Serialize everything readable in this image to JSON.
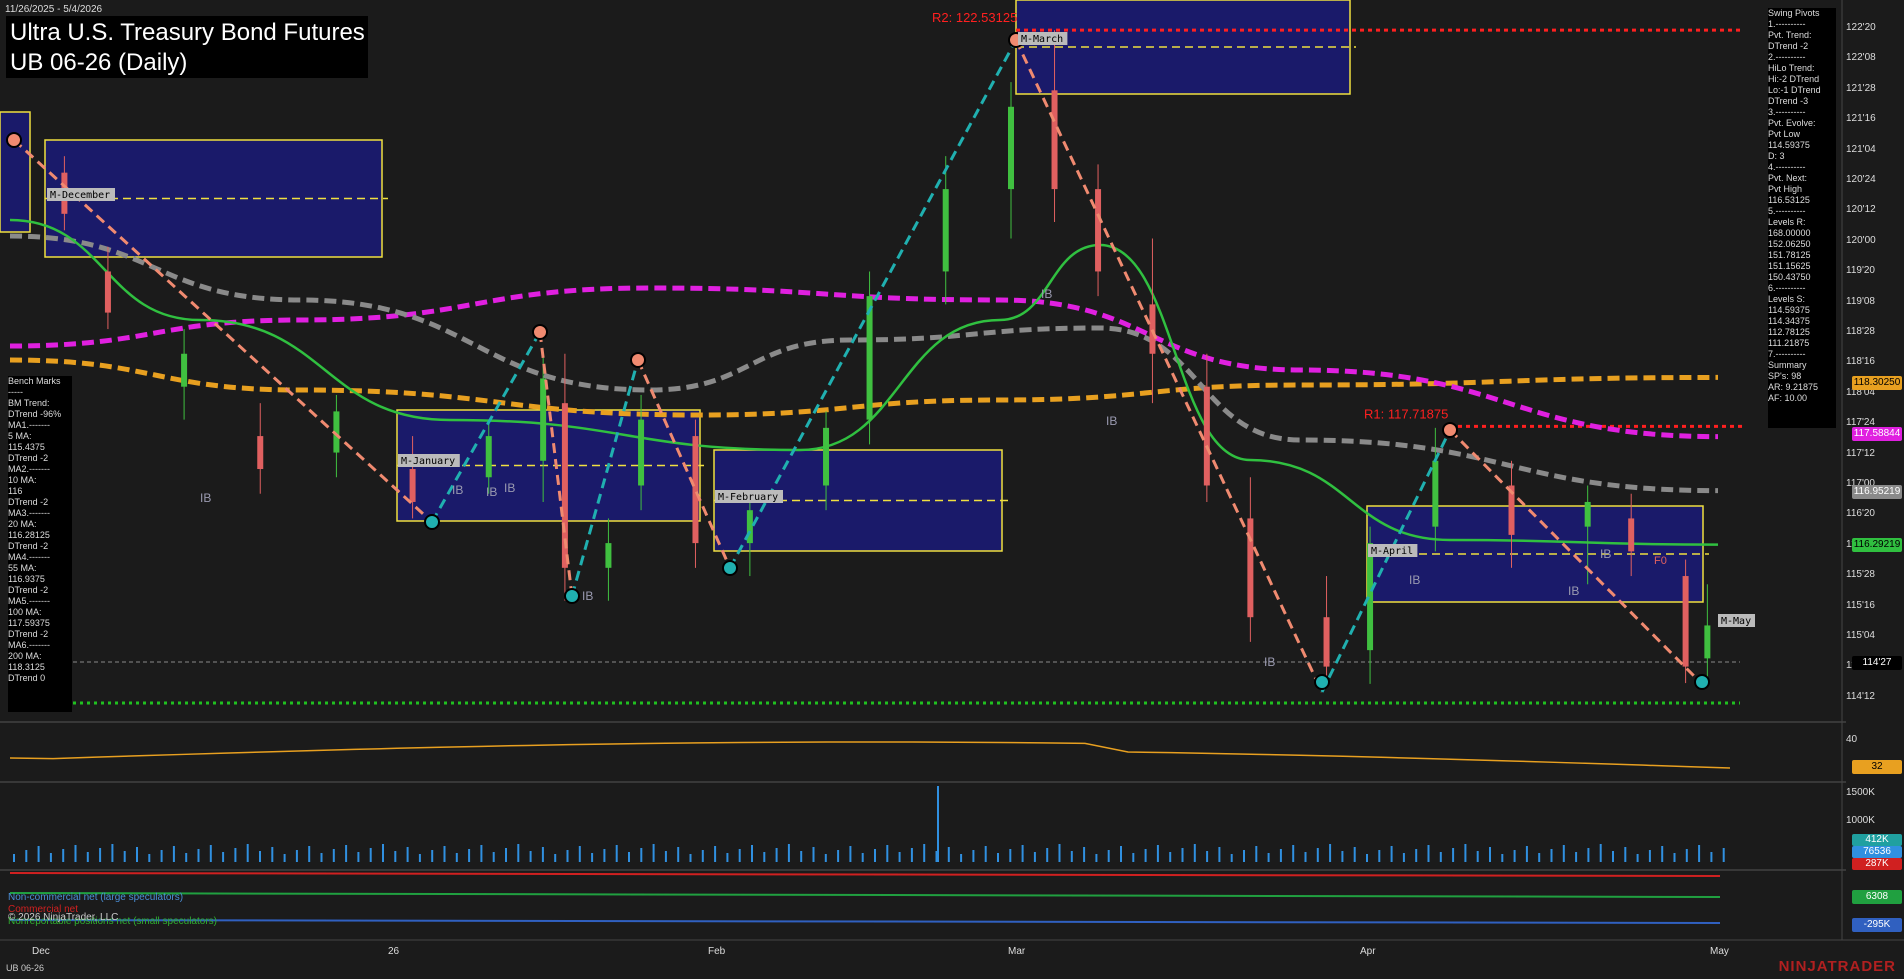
{
  "window": {
    "date_range": "11/26/2025 - 5/4/2026",
    "title_line1": "Ultra U.S. Treasury Bond Futures",
    "title_line2": "UB 06-26 (Daily)",
    "instrument_footer": "UB 06-26",
    "brand": "NINJATRADER",
    "copyright": "© 2026 NinjaTrader, LLC"
  },
  "swing_pivots": [
    "Swing Pivots",
    "1.----------",
    "Pvt. Trend:",
    "DTrend -2",
    "2.----------",
    "HiLo Trend:",
    "Hi:-2 DTrend",
    "Lo:-1 DTrend",
    "DTrend -3",
    "3.----------",
    "Pvt. Evolve:",
    "Pvt Low",
    "114.59375",
    "D: 3",
    "4.----------",
    "Pvt. Next:",
    "Pvt High",
    "116.53125",
    "5.----------",
    "Levels R:",
    "168.00000",
    "152.06250",
    "151.78125",
    "151.15625",
    "150.43750",
    "6.----------",
    "Levels S:",
    "114.59375",
    "114.34375",
    "112.78125",
    "111.21875",
    "7.----------",
    "Summary",
    "SP's: 98",
    "AR: 9.21875",
    "AF: 10.00"
  ],
  "bench_marks": [
    "Bench Marks",
    "-----",
    "BM Trend:",
    "DTrend -96%",
    "MA1.-------",
    "5 MA:",
    "115.4375",
    "DTrend -2",
    "MA2.-------",
    "10 MA:",
    "116",
    "DTrend -2",
    "MA3.-------",
    "20 MA:",
    "116.28125",
    "DTrend -2",
    "MA4.-------",
    "55 MA:",
    "116.9375",
    "DTrend -2",
    "MA5.-------",
    "100 MA:",
    "117.59375",
    "DTrend -2",
    "MA6.-------",
    "200 MA:",
    "118.3125",
    "DTrend 0"
  ],
  "price_axis": {
    "labels": [
      "122'20",
      "122'08",
      "121'28",
      "121'16",
      "121'04",
      "120'24",
      "120'12",
      "120'00",
      "119'20",
      "119'08",
      "118'28",
      "118'16",
      "118'04",
      "117'24",
      "117'12",
      "117'00",
      "116'20",
      "116'08",
      "115'28",
      "115'16",
      "115'04",
      "114'24",
      "114'12"
    ],
    "tags": [
      {
        "text": "118.30250",
        "bg": "#e8a020",
        "fg": "#000"
      },
      {
        "text": "117.58844",
        "bg": "#e020e0",
        "fg": "#fff"
      },
      {
        "text": "116.95219",
        "bg": "#8a8a8a",
        "fg": "#fff"
      },
      {
        "text": "116.29219",
        "bg": "#30c040",
        "fg": "#000"
      },
      {
        "text": "114'27",
        "bg": "#000",
        "fg": "#fff"
      }
    ]
  },
  "time_axis": [
    "Dec",
    "26",
    "Feb",
    "Mar",
    "Apr",
    "May"
  ],
  "annotations": {
    "r2": "R2: 122.53125",
    "r1": "R1: 117.71875",
    "months": [
      "M-December",
      "M-January",
      "M-February",
      "M-March",
      "M-April",
      "M-May"
    ],
    "ib": "IB",
    "f0": "F0"
  },
  "sub_panels": {
    "osc_labels": [
      "40"
    ],
    "osc_tag": {
      "text": "32",
      "bg": "#e8a020",
      "fg": "#000"
    },
    "vol_labels": [
      "1500K",
      "1000K"
    ],
    "vol_tags": [
      {
        "text": "412K",
        "bg": "#20a0a0",
        "fg": "#fff"
      },
      {
        "text": "76536",
        "bg": "#3090e0",
        "fg": "#fff"
      },
      {
        "text": "287K",
        "bg": "#d02020",
        "fg": "#fff"
      }
    ],
    "cot_tags": [
      {
        "text": "6308",
        "bg": "#20a040",
        "fg": "#fff"
      },
      {
        "text": "-295K",
        "bg": "#3060c0",
        "fg": "#fff"
      }
    ],
    "legend": [
      {
        "text": "Non-commercial net (large speculators)",
        "color": "#4a8fd8"
      },
      {
        "text": "Commercial net",
        "color": "#d02020"
      },
      {
        "text": "Nonreportable positions net (small speculators)",
        "color": "#30b030"
      }
    ]
  },
  "colors": {
    "background": "#1b1b1b",
    "up_candle": "#40c040",
    "down_candle": "#e06060",
    "ma_magenta": "#e020e0",
    "ma_orange": "#e8a020",
    "ma_gray": "#8a8a8a",
    "ma_green": "#30c040",
    "swing_teal": "#20b0b0",
    "swing_salmon": "#f08a70",
    "box_fill": "#1a1a6a",
    "box_border": "#f0e040"
  },
  "chart_data": {
    "type": "candlestick",
    "title": "UB 06-26 (Daily)",
    "y_unit": "price (points and 32nds)",
    "ylim": [
      114.2,
      122.8
    ],
    "x_range": [
      "2025-11-26",
      "2026-05-04"
    ],
    "ohlc": [
      {
        "date": "2025-12-01",
        "o": 120.8,
        "h": 121.0,
        "l": 120.1,
        "c": 120.3
      },
      {
        "date": "2025-12-05",
        "o": 119.6,
        "h": 119.9,
        "l": 118.9,
        "c": 119.1
      },
      {
        "date": "2025-12-12",
        "o": 118.2,
        "h": 118.9,
        "l": 117.8,
        "c": 118.6
      },
      {
        "date": "2025-12-19",
        "o": 117.6,
        "h": 118.0,
        "l": 116.9,
        "c": 117.2
      },
      {
        "date": "2025-12-26",
        "o": 117.4,
        "h": 118.1,
        "l": 117.1,
        "c": 117.9
      },
      {
        "date": "2026-01-02",
        "o": 117.2,
        "h": 117.6,
        "l": 116.6,
        "c": 116.8
      },
      {
        "date": "2026-01-09",
        "o": 117.1,
        "h": 117.8,
        "l": 116.9,
        "c": 117.6
      },
      {
        "date": "2026-01-14",
        "o": 117.3,
        "h": 118.6,
        "l": 116.8,
        "c": 118.3
      },
      {
        "date": "2026-01-16",
        "o": 118.0,
        "h": 118.6,
        "l": 115.6,
        "c": 116.0
      },
      {
        "date": "2026-01-20",
        "o": 116.0,
        "h": 116.6,
        "l": 115.6,
        "c": 116.3
      },
      {
        "date": "2026-01-23",
        "o": 117.0,
        "h": 118.1,
        "l": 116.7,
        "c": 117.8
      },
      {
        "date": "2026-01-28",
        "o": 117.6,
        "h": 117.8,
        "l": 116.0,
        "c": 116.3
      },
      {
        "date": "2026-02-02",
        "o": 116.3,
        "h": 116.9,
        "l": 115.9,
        "c": 116.7
      },
      {
        "date": "2026-02-09",
        "o": 117.0,
        "h": 117.9,
        "l": 116.7,
        "c": 117.7
      },
      {
        "date": "2026-02-13",
        "o": 117.8,
        "h": 119.6,
        "l": 117.5,
        "c": 119.3
      },
      {
        "date": "2026-02-20",
        "o": 119.6,
        "h": 121.0,
        "l": 119.2,
        "c": 120.6
      },
      {
        "date": "2026-02-26",
        "o": 120.6,
        "h": 121.9,
        "l": 120.0,
        "c": 121.6
      },
      {
        "date": "2026-03-02",
        "o": 121.8,
        "h": 122.53,
        "l": 120.2,
        "c": 120.6
      },
      {
        "date": "2026-03-06",
        "o": 120.6,
        "h": 120.9,
        "l": 119.3,
        "c": 119.6
      },
      {
        "date": "2026-03-11",
        "o": 119.2,
        "h": 120.0,
        "l": 118.0,
        "c": 118.6
      },
      {
        "date": "2026-03-16",
        "o": 118.2,
        "h": 118.6,
        "l": 116.8,
        "c": 117.0
      },
      {
        "date": "2026-03-20",
        "o": 116.6,
        "h": 117.1,
        "l": 115.1,
        "c": 115.4
      },
      {
        "date": "2026-03-27",
        "o": 115.4,
        "h": 115.9,
        "l": 114.6,
        "c": 114.8
      },
      {
        "date": "2026-03-31",
        "o": 115.0,
        "h": 116.5,
        "l": 114.59,
        "c": 116.3
      },
      {
        "date": "2026-04-06",
        "o": 116.5,
        "h": 117.7,
        "l": 116.2,
        "c": 117.3
      },
      {
        "date": "2026-04-13",
        "o": 117.0,
        "h": 117.3,
        "l": 116.0,
        "c": 116.4
      },
      {
        "date": "2026-04-20",
        "o": 116.5,
        "h": 117.0,
        "l": 115.8,
        "c": 116.8
      },
      {
        "date": "2026-04-24",
        "o": 116.6,
        "h": 116.9,
        "l": 115.9,
        "c": 116.2
      },
      {
        "date": "2026-04-29",
        "o": 115.9,
        "h": 116.1,
        "l": 114.6,
        "c": 114.8
      },
      {
        "date": "2026-05-01",
        "o": 114.9,
        "h": 115.8,
        "l": 114.6,
        "c": 115.3
      }
    ],
    "moving_averages": [
      {
        "name": "200 MA",
        "value": 118.3125,
        "color": "#e8a020"
      },
      {
        "name": "100 MA",
        "value": 117.59375,
        "color": "#e020e0"
      },
      {
        "name": "55 MA",
        "value": 116.9375,
        "color": "#8a8a8a"
      },
      {
        "name": "20 MA",
        "value": 116.28125,
        "color": "#30c040"
      }
    ],
    "levels": [
      {
        "label": "R2: 122.53125",
        "value": 122.53125,
        "color": "#ff2020"
      },
      {
        "label": "R1: 117.71875",
        "value": 117.71875,
        "color": "#ff2020"
      }
    ]
  }
}
